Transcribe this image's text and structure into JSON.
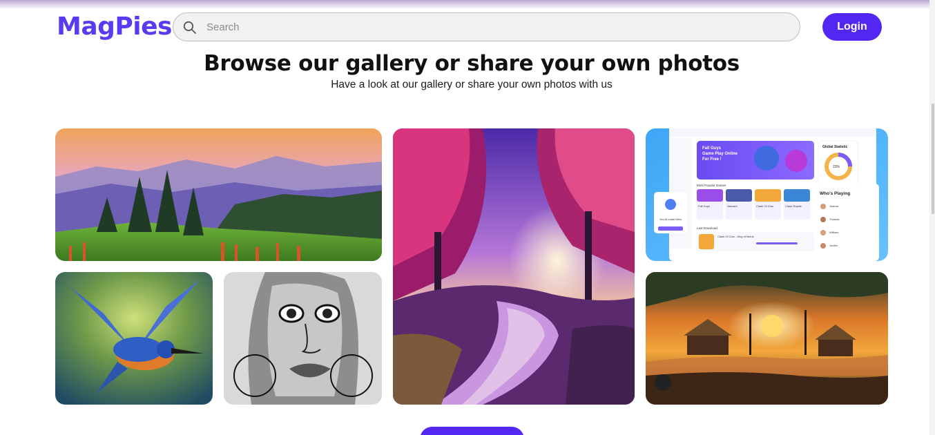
{
  "header": {
    "logo": "MagPies",
    "search": {
      "placeholder": "Search",
      "value": "",
      "icon": "search-icon"
    },
    "login_label": "Login"
  },
  "hero": {
    "title": "Browse our gallery or share your own photos",
    "subtitle": "Have a look at our gallery or share your own photos with us"
  },
  "gallery": {
    "dashboard": {
      "promo_title": "Fall Guys Game Play Online For Free !",
      "stats_title": "Global Statistic",
      "stats_value": "23%",
      "popular_title": "Most Popular Games",
      "popular_games": [
        "Fall Guys",
        "Valorant",
        "Clash Of Clan",
        "Clash Royale"
      ],
      "recent_title": "Last Download",
      "recent_item": "Clash Of Clan - King of Nerds",
      "unlock_text": "You Al made Here Still Now!",
      "players_title": "Who's Playing",
      "players": [
        "Joshua",
        "Thomas",
        "William",
        "Jenifer"
      ]
    }
  },
  "colors": {
    "brand": "#5b3bf0",
    "button": "#5227f2"
  }
}
